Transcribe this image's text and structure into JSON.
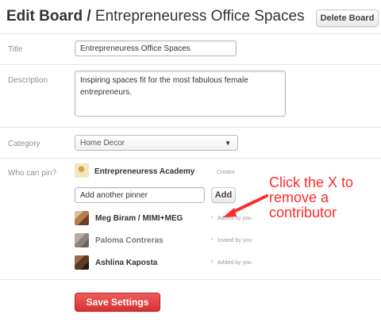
{
  "header": {
    "title_prefix": "Edit Board /",
    "title_name": "Entrepreneuress Office Spaces",
    "delete_button": "Delete Board"
  },
  "form": {
    "title_label": "Title",
    "title_value": "Entrepreneuress Office Spaces",
    "description_label": "Description",
    "description_value": "Inspiring spaces fit for the most fabulous female entrepreneurs.",
    "category_label": "Category",
    "category_value": "Home Decor",
    "who_can_pin_label": "Who can pin?"
  },
  "owner": {
    "name": "Entrepreneuress Academy",
    "role": "Creator",
    "avatar": "academy"
  },
  "add_pinner": {
    "placeholder": "Add another pinner",
    "button_label": "Add"
  },
  "pinners": [
    {
      "name": "Meg Biram / MIMI+MEG",
      "status": "Added by you",
      "avatar": "meg"
    },
    {
      "name": "Paloma Contreras",
      "status": "Invited by you",
      "avatar": "paloma"
    },
    {
      "name": "Ashlina Kaposta",
      "status": "Added by you",
      "avatar": "ashlina"
    }
  ],
  "annotation": {
    "text": "Click the X to\nremove a\ncontributor",
    "color": "#ff2b2b"
  },
  "footer": {
    "save_button": "Save Settings"
  },
  "colors": {
    "primary": "#d83131",
    "text": "#333333",
    "label": "#8f8f8f"
  },
  "icons": {
    "dropdown": "chevron-down-icon",
    "remove": "close-icon",
    "annotation_arrow": "arrow-icon"
  }
}
